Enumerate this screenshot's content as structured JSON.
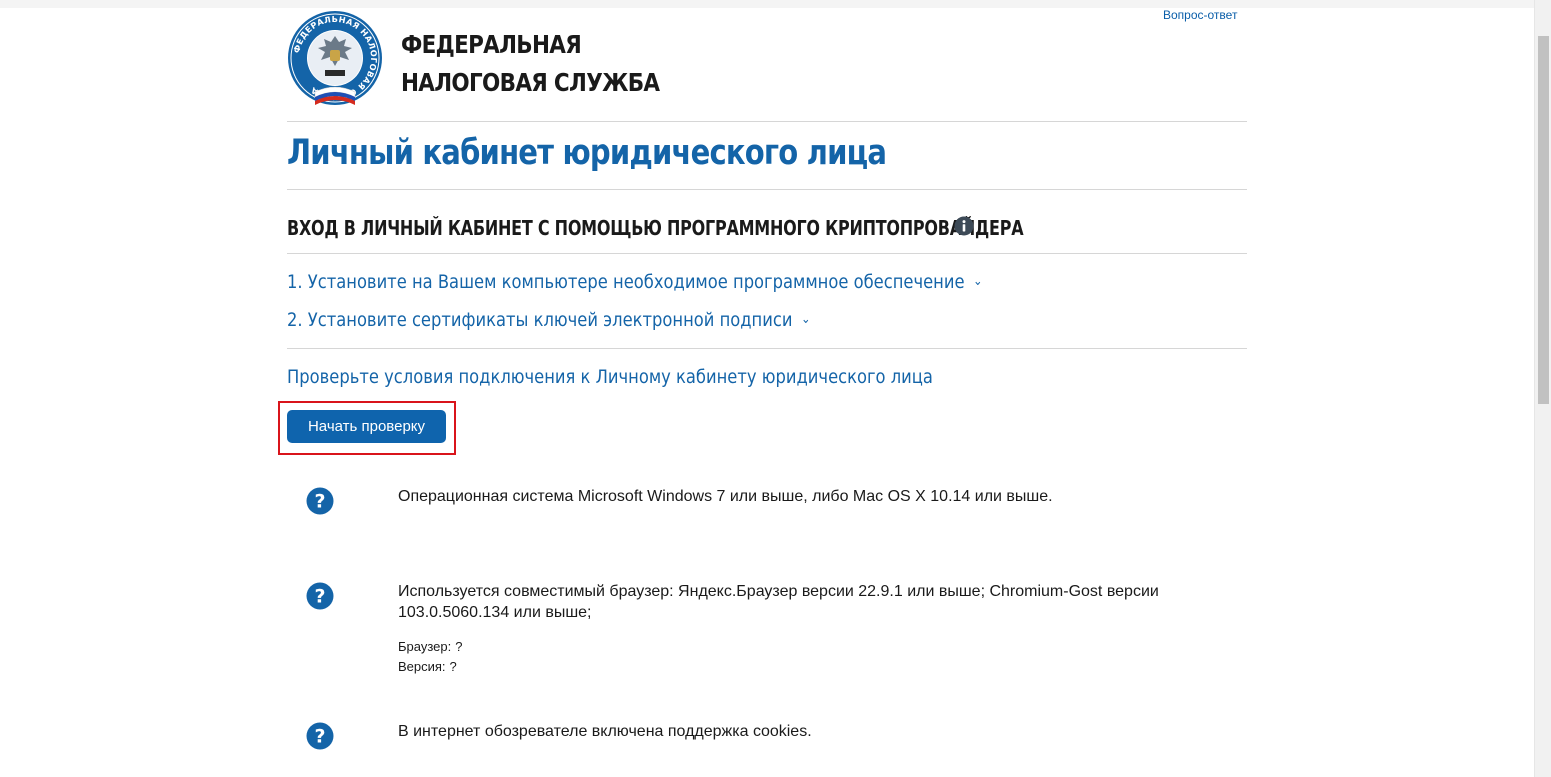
{
  "header": {
    "faq_link": "Вопрос-ответ",
    "org_name_line1": "ФЕДЕРАЛЬНАЯ",
    "org_name_line2": "НАЛОГОВАЯ СЛУЖБА",
    "logo_ring_text": "ФЕДЕРАЛЬНАЯ НАЛОГОВАЯ СЛУЖБА"
  },
  "main": {
    "page_title": "Личный кабинет юридического лица",
    "section_title": "ВХОД В ЛИЧНЫЙ КАБИНЕТ С ПОМОЩЬЮ ПРОГРАММНОГО КРИПТОПРОВАЙДЕРА",
    "steps": [
      {
        "label": "1. Установите на Вашем компьютере необходимое программное обеспечение"
      },
      {
        "label": "2. Установите сертификаты ключей электронной подписи"
      }
    ],
    "check_title": "Проверьте условия подключения к Личному кабинету юридического лица",
    "start_button": "Начать проверку",
    "requirements": [
      {
        "text": "Операционная система Microsoft Windows 7 или выше, либо Mac OS X 10.14 или выше."
      },
      {
        "text": "Используется совместимый браузер: Яндекс.Браузер версии 22.9.1 или выше; Chromium-Gost версии 103.0.5060.134 или выше;",
        "browser_label": "Браузер:",
        "browser_value": "?",
        "version_label": "Версия:",
        "version_value": "?"
      },
      {
        "text": "В интернет обозревателе включена поддержка cookies."
      }
    ]
  },
  "colors": {
    "brand_blue": "#1464a8",
    "button_blue": "#0f64ad",
    "highlight_red": "#d9141b",
    "divider": "#d6d6d6"
  },
  "icons": {
    "info": "info-icon",
    "question": "question-circle-icon",
    "chevron": "chevron-down-icon",
    "logo": "fns-emblem-logo"
  }
}
